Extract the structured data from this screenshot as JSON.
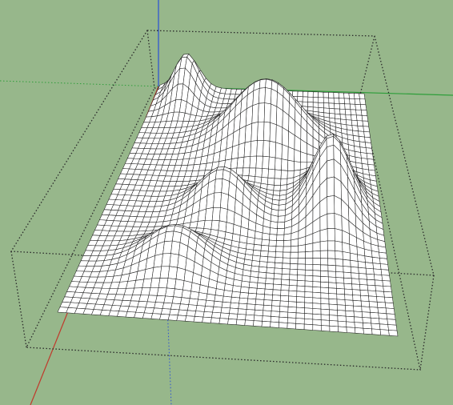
{
  "viewport": {
    "background": "#97b78b",
    "colors": {
      "axis_red": "#c0392b",
      "axis_green": "#2e9e3a",
      "axis_blue": "#2a4fd6",
      "bounding_box": "#2a2a2a",
      "mesh_line": "#222222",
      "mesh_face": "#ffffff"
    },
    "icons": [
      "axis-origin"
    ],
    "model": {
      "type": "terrain-mesh",
      "grid_columns": 40,
      "grid_rows": 44,
      "bumps": [
        {
          "name": "hill-back-left",
          "u": 0.14,
          "v": 0.04,
          "height": 0.55
        },
        {
          "name": "ridge-back-center",
          "u": 0.55,
          "v": 0.23,
          "height": 0.85
        },
        {
          "name": "hill-middle-left",
          "u": 0.42,
          "v": 0.52,
          "height": 0.55
        },
        {
          "name": "peak-middle-right",
          "u": 0.82,
          "v": 0.5,
          "height": 1.0
        },
        {
          "name": "hill-front-left",
          "u": 0.3,
          "v": 0.76,
          "height": 0.48
        }
      ]
    }
  }
}
